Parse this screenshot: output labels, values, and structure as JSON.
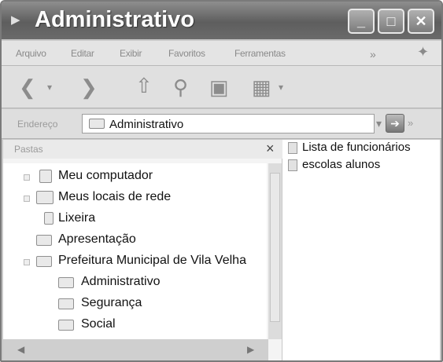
{
  "window": {
    "title": "Administrativo"
  },
  "menu": [
    "Arquivo",
    "Editar",
    "Exibir",
    "Favoritos",
    "Ferramentas"
  ],
  "address": {
    "label": "Endereço",
    "value": "Administrativo"
  },
  "folders_pane": {
    "title": "Pastas",
    "close": "×"
  },
  "tree": [
    {
      "label": "Meu computador",
      "icon": "computer-icon"
    },
    {
      "label": "Meus locais de rede",
      "icon": "network-icon"
    },
    {
      "label": "Lixeira",
      "icon": "recycle-bin-icon"
    },
    {
      "label": "Apresentação",
      "icon": "folder-icon"
    },
    {
      "label": "Prefeitura Municipal de Vila Velha",
      "icon": "folder-icon"
    },
    {
      "label": "Administrativo",
      "icon": "folder-icon"
    },
    {
      "label": "Segurança",
      "icon": "folder-icon"
    },
    {
      "label": "Social",
      "icon": "folder-icon"
    }
  ],
  "files": [
    {
      "label": "Lista de funcionários",
      "icon": "document-icon"
    },
    {
      "label": "escolas alunos",
      "icon": "document-icon"
    }
  ]
}
